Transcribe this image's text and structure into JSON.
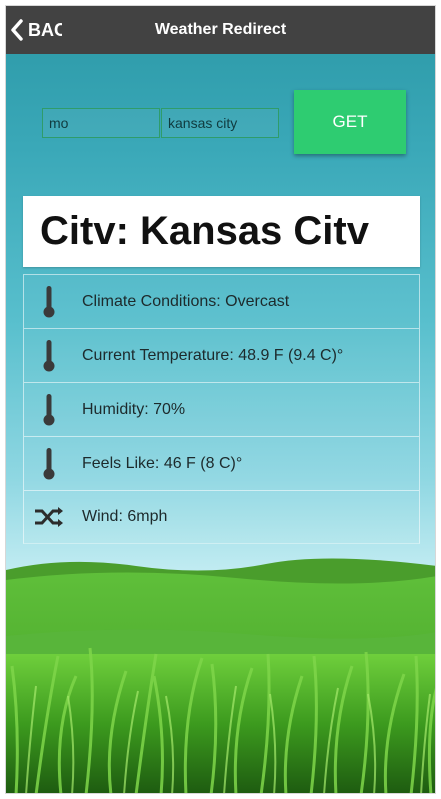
{
  "header": {
    "back_label": "BACK",
    "title": "Weather Redirect"
  },
  "form": {
    "state_value": "mo",
    "city_value": "kansas city",
    "get_label": "GET"
  },
  "result": {
    "city_label": "Citv: Kansas Citv"
  },
  "conditions": [
    {
      "icon": "thermometer-icon",
      "text": "Climate Conditions: Overcast"
    },
    {
      "icon": "thermometer-icon",
      "text": "Current Temperature: 48.9 F (9.4 C)°"
    },
    {
      "icon": "thermometer-icon",
      "text": "Humidity: 70%"
    },
    {
      "icon": "thermometer-icon",
      "text": "Feels Like: 46 F (8 C)°"
    },
    {
      "icon": "wind-shuffle-icon",
      "text": "Wind: 6mph"
    }
  ],
  "colors": {
    "topbar": "#424242",
    "button": "#2ecc71",
    "sky_top": "#2b98a6",
    "grass": "#4fae2e"
  }
}
